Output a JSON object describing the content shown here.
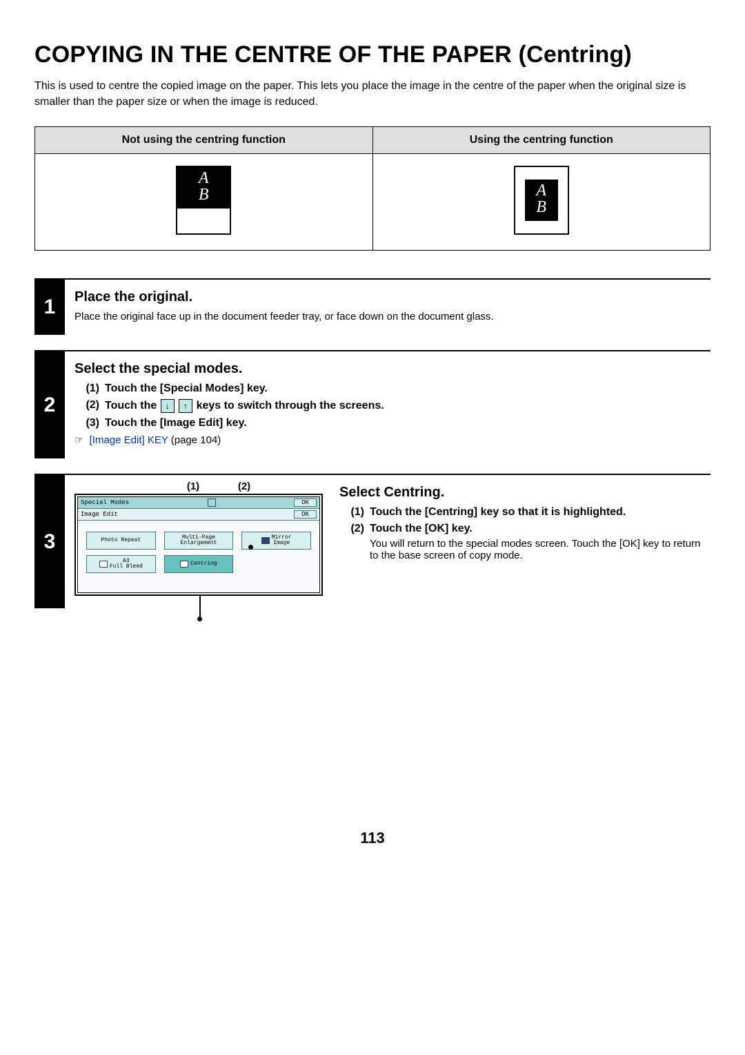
{
  "title": "COPYING IN THE CENTRE OF THE PAPER (Centring)",
  "intro": "This is used to centre the copied image on the paper.\nThis lets you place the image in the centre of the paper when the original size is smaller than the paper size or when the image is reduced.",
  "compare": {
    "left_header": "Not using the centring function",
    "right_header": "Using the centring function",
    "glyph1": "A",
    "glyph2": "B"
  },
  "steps": [
    {
      "num": "1",
      "heading": "Place the original.",
      "text": "Place the original face up in the document feeder tray, or face down on the document glass."
    },
    {
      "num": "2",
      "heading": "Select the special modes.",
      "subs": [
        {
          "label": "Touch the [Special Modes] key."
        },
        {
          "label_before": "Touch the ",
          "label_after": " keys to switch through the screens.",
          "has_arrows": true
        },
        {
          "label": "Touch the [Image Edit] key."
        }
      ],
      "ref_prefix": "☞",
      "ref_link": "[Image Edit] KEY",
      "ref_tail": " (page 104)"
    },
    {
      "num": "3",
      "heading": "Select Centring.",
      "callouts": {
        "c1": "(1)",
        "c2": "(2)"
      },
      "screen": {
        "titlebar": "Special Modes",
        "subtitle": "Image Edit",
        "ok": "OK",
        "keys": [
          {
            "label": "Photo Repeat"
          },
          {
            "label": "Multi-Page\nEnlargement"
          },
          {
            "label": "Mirror\nImage"
          },
          {
            "label": "A3\nFull Bleed"
          },
          {
            "label": "Centring",
            "selected": true
          }
        ]
      },
      "subs": [
        {
          "label": "Touch the [Centring] key so that it is highlighted."
        },
        {
          "label": "Touch the [OK] key.",
          "note": "You will return to the special modes screen. Touch the [OK] key to return to the base screen of copy mode."
        }
      ]
    }
  ],
  "page_number": "113"
}
